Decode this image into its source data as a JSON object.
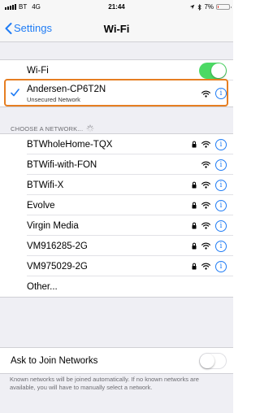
{
  "status_bar": {
    "carrier": "BT",
    "network": "4G",
    "time": "21:44",
    "battery_percent_text": "7%",
    "battery_level_fraction": 0.07,
    "battery_color": "#e53b30"
  },
  "nav": {
    "back_label": "Settings",
    "title": "Wi-Fi"
  },
  "wifi_toggle": {
    "label": "Wi-Fi",
    "on": true,
    "on_color": "#4cd964"
  },
  "connected": {
    "name": "Andersen-CP6T2N",
    "subtitle": "Unsecured Network",
    "highlight_color": "#e67e22"
  },
  "section": {
    "header": "CHOOSE A NETWORK..."
  },
  "networks": [
    {
      "name": "BTWholeHome-TQX",
      "secured": true
    },
    {
      "name": "BTWifi-with-FON",
      "secured": false
    },
    {
      "name": "BTWifi-X",
      "secured": true
    },
    {
      "name": "Evolve",
      "secured": true
    },
    {
      "name": "Virgin Media",
      "secured": true
    },
    {
      "name": "VM916285-2G",
      "secured": true
    },
    {
      "name": "VM975029-2G",
      "secured": true
    }
  ],
  "other_label": "Other...",
  "ask_to_join": {
    "label": "Ask to Join Networks",
    "on": false
  },
  "footer": "Known networks will be joined automatically. If no known networks are available, you will have to manually select a network.",
  "accent_color": "#1f7cf5"
}
